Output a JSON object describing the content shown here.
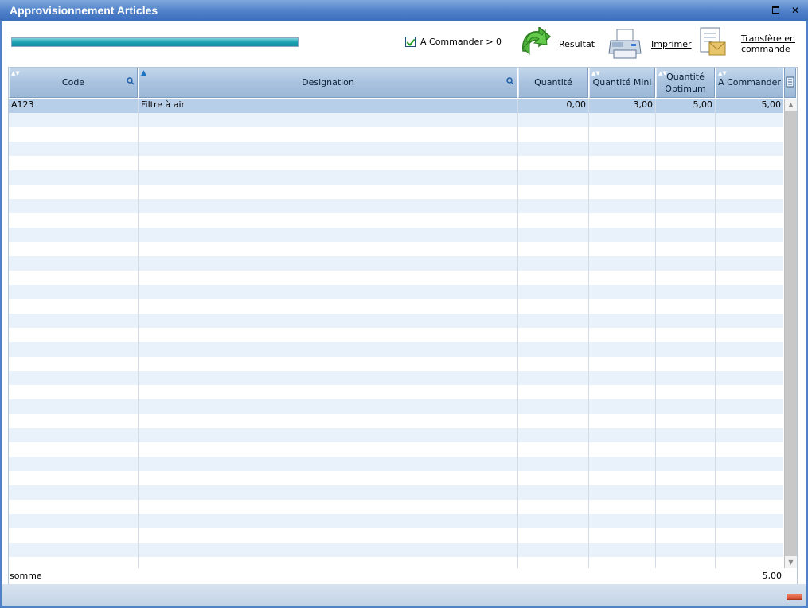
{
  "window": {
    "title": "Approvisionnement Articles"
  },
  "toolbar": {
    "progress": 1.0,
    "filter_checkbox": {
      "label": "A Commander > 0",
      "checked": true
    },
    "resultat_label": "Resultat",
    "imprimer_label": "Imprimer",
    "transfer_label_1": "Transfère en",
    "transfer_label_2": "commande"
  },
  "grid": {
    "columns": [
      {
        "label": "Code"
      },
      {
        "label": "Designation"
      },
      {
        "label": "Quantité"
      },
      {
        "label": "Quantité Mini"
      },
      {
        "label_1": "Quantité",
        "label_2": "Optimum"
      },
      {
        "label": "A Commander"
      }
    ],
    "rows": [
      {
        "code": "A123",
        "designation": "Filtre à air",
        "quantite": "0,00",
        "quantite_mini": "3,00",
        "quantite_optimum": "5,00",
        "a_commander": "5,00"
      }
    ],
    "footer": {
      "label": "somme",
      "total": "5,00"
    }
  },
  "colors": {
    "title_bar": "#4f80c8",
    "header": "#a9c3df",
    "alt_row": "#e9f1fa",
    "selected_row": "#b7cfe8",
    "progress": "#1aa2b3"
  }
}
